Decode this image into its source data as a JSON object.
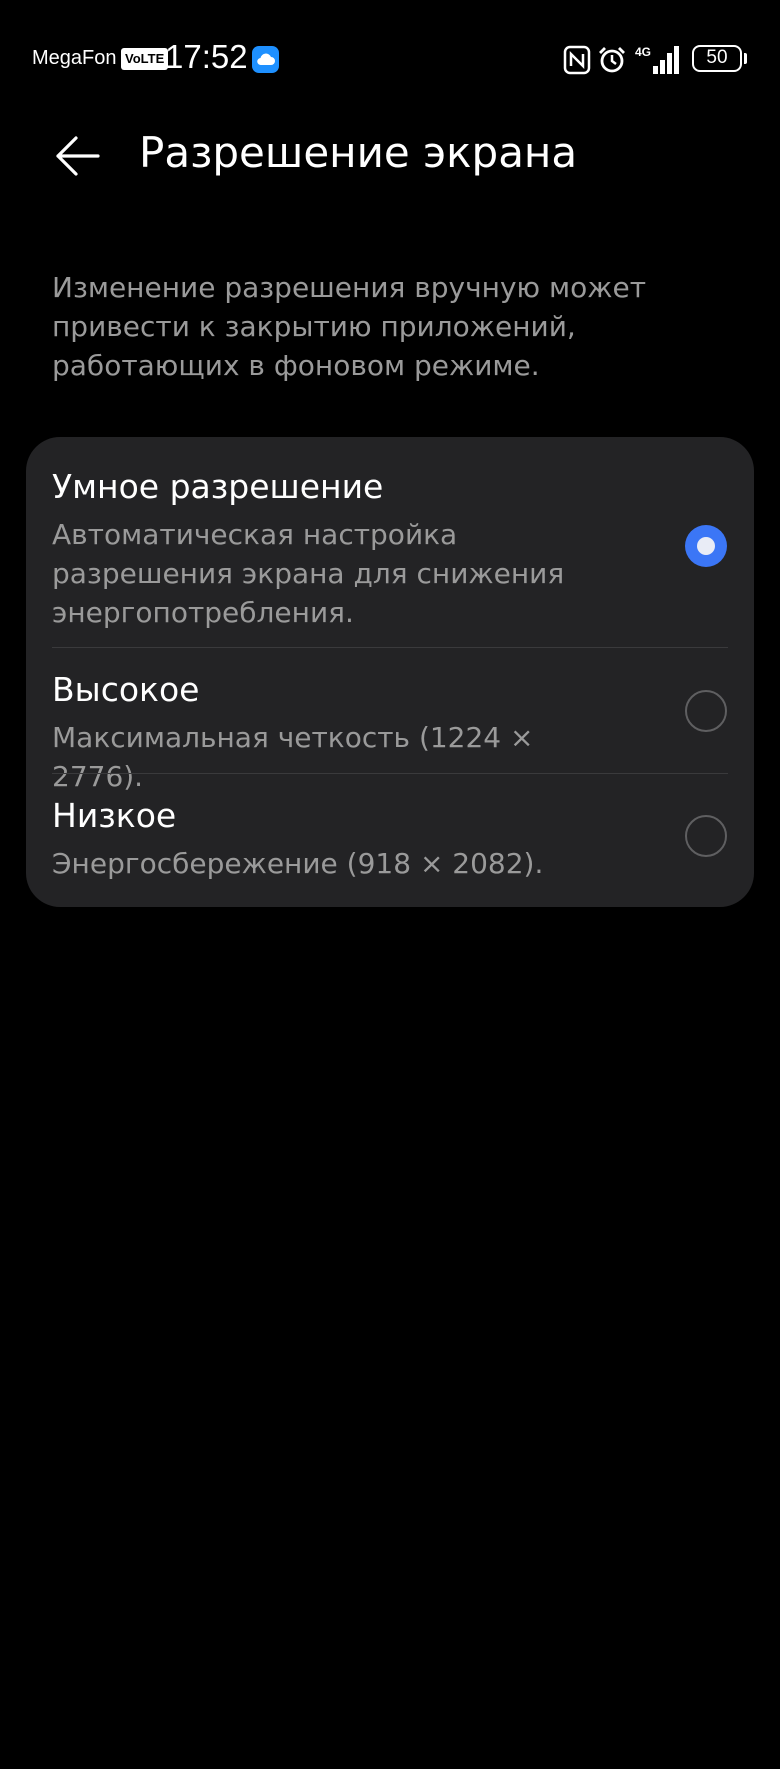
{
  "status_bar": {
    "carrier": "MegaFon",
    "volte": "VoLTE",
    "time": "17:52",
    "network": "4G",
    "battery": "50",
    "icons": [
      "cloud-icon",
      "nfc-icon",
      "alarm-icon",
      "signal-icon",
      "battery-icon"
    ]
  },
  "header": {
    "back_icon": "arrow-left-icon",
    "title": "Разрешение экрана"
  },
  "description": "Изменение разрешения вручную может привести к закрытию приложений, работающих в фоновом режиме.",
  "options": [
    {
      "title": "Умное разрешение",
      "description": "Автоматическая настройка разрешения экрана для снижения энергопотребления.",
      "selected": true
    },
    {
      "title": "Высокое",
      "description": "Максимальная четкость (1224 × 2776).",
      "selected": false
    },
    {
      "title": "Низкое",
      "description": "Энергосбережение (918 × 2082).",
      "selected": false
    }
  ],
  "colors": {
    "background": "#000000",
    "card": "#232325",
    "accent": "#3b76f6",
    "secondary_text": "#9a9a9a"
  }
}
